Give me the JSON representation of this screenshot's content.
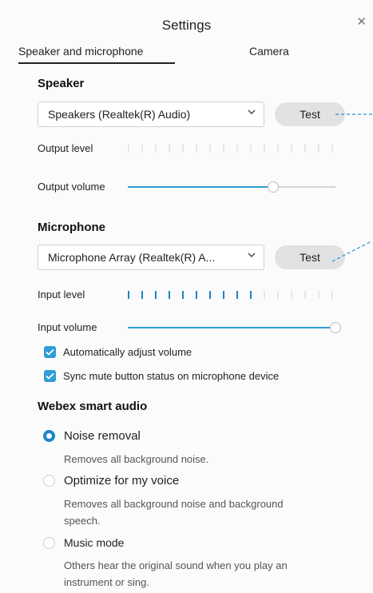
{
  "window": {
    "title": "Settings"
  },
  "tabs": [
    {
      "label": "Speaker and microphone"
    },
    {
      "label": "Camera"
    }
  ],
  "speaker": {
    "heading": "Speaker",
    "device": "Speakers (Realtek(R) Audio)",
    "test_label": "Test",
    "output_level_label": "Output level",
    "output_level_fraction": 0.0,
    "output_volume_label": "Output volume",
    "output_volume_fraction": 0.7
  },
  "microphone": {
    "heading": "Microphone",
    "device": "Microphone Array (Realtek(R) A...",
    "test_label": "Test",
    "input_level_label": "Input level",
    "input_level_fraction": 0.625,
    "input_volume_label": "Input volume",
    "input_volume_fraction": 1.0,
    "checkboxes": [
      {
        "label": "Automatically adjust volume",
        "checked": true
      },
      {
        "label": "Sync mute button status on microphone device",
        "checked": true
      }
    ]
  },
  "smart_audio": {
    "heading": "Webex smart audio",
    "options": [
      {
        "label": "Noise removal",
        "selected": true,
        "description_lines": [
          "Removes all background noise."
        ]
      },
      {
        "label": "Optimize for my voice",
        "selected": false,
        "description_lines": [
          "Removes all background noise and background",
          "speech."
        ]
      },
      {
        "label": "Music mode",
        "selected": false,
        "description_lines": [
          "Others hear the original sound when you play an",
          "instrument or sing."
        ]
      }
    ]
  },
  "colors": {
    "accent": "#2f9dd6",
    "radio_selected": "#1b86c8",
    "level_active": "#1b86c8",
    "level_inactive": "#e6e6e6"
  }
}
